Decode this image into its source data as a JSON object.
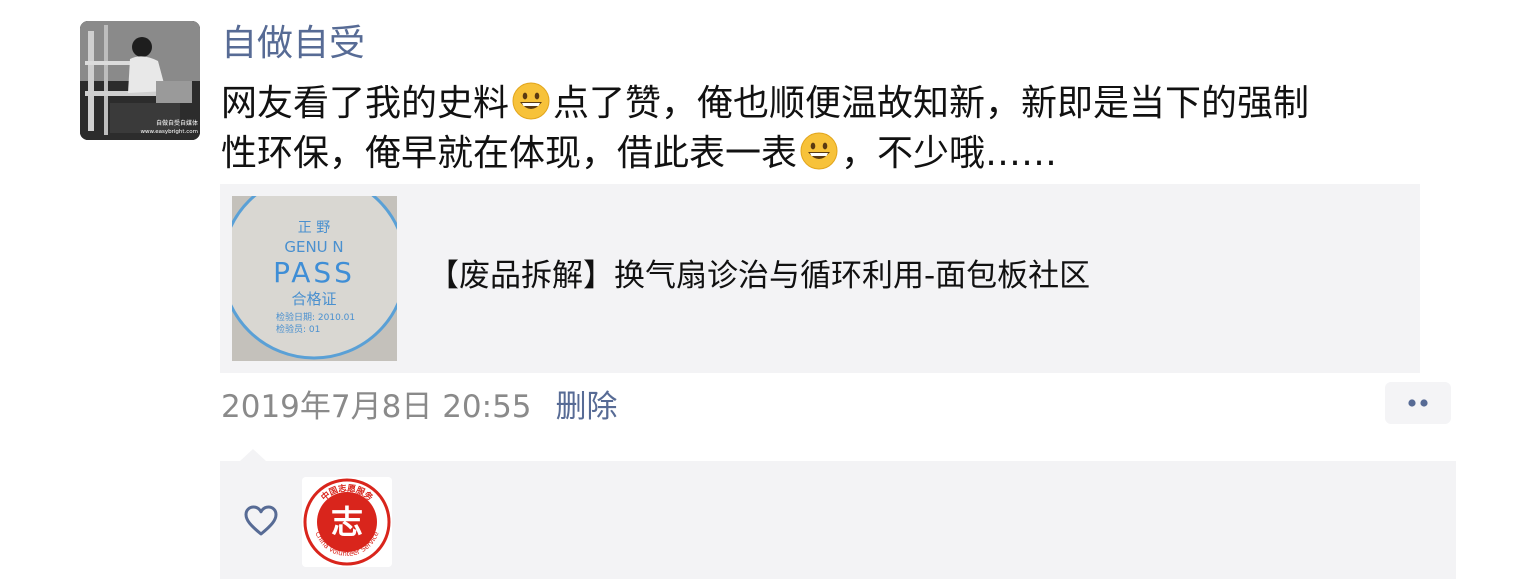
{
  "post": {
    "author": "自做自受",
    "content": {
      "line1_a": "网友看了我的史料",
      "line1_b": "点了赞，俺也顺便温故知新，新即是当下的强制",
      "line2_a": "性环保，俺早就在体现，借此表一表",
      "line2_b": "，不少哦……",
      "emoji": "grinning-face-icon"
    },
    "link": {
      "title": "【废品拆解】换气扇诊治与循环利用-面包板社区",
      "thumbnail": {
        "line1": "正 野",
        "line2": "GENU N",
        "line3": "PASS",
        "line4": "合格证",
        "line5": "检验日期: 2010.01",
        "line6": "检验员: 01"
      }
    },
    "timestamp": "2019年7月8日 20:55",
    "delete_label": "删除",
    "avatar": {
      "watermark_line1": "自做自受自媒体",
      "watermark_line2": "www.easybright.com"
    }
  },
  "likes": {
    "icon": "heart-outline-icon",
    "likers": [
      {
        "avatar_text_top": "中国志愿服务",
        "avatar_text_bottom": "China Volunteer Service",
        "mark": "志"
      }
    ]
  },
  "colors": {
    "link_blue": "#576b95",
    "panel_gray": "#f3f3f5",
    "meta_gray": "#8a8a8a",
    "volunteer_red": "#d9251c"
  }
}
